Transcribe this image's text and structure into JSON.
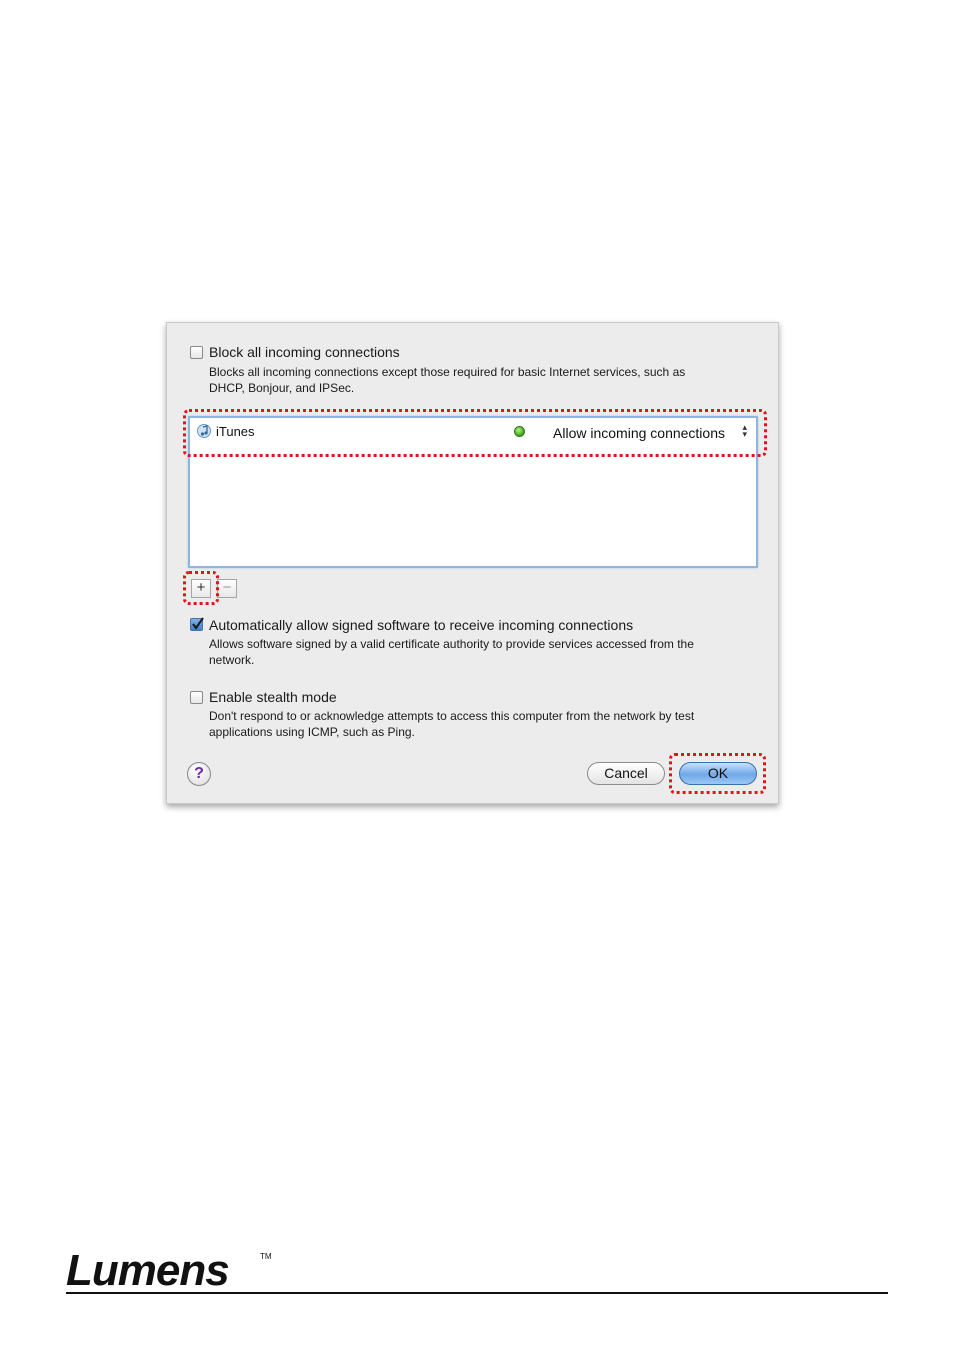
{
  "dialog": {
    "block": {
      "title": "Block all incoming connections",
      "desc": "Blocks all incoming connections except those required for basic Internet services, such as DHCP, Bonjour, and IPSec.",
      "checked": false
    },
    "list": {
      "rows": [
        {
          "app_name": "iTunes",
          "status": "Allow incoming connections",
          "status_color": "#3aa314"
        }
      ]
    },
    "add_label": "+",
    "remove_label": "−",
    "auto_allow": {
      "title": "Automatically allow signed software to receive incoming connections",
      "desc": "Allows software signed by a valid certificate authority to provide services accessed from the network.",
      "checked": true
    },
    "stealth": {
      "title": "Enable stealth mode",
      "desc": "Don't respond to or acknowledge attempts to access this computer from the network by test applications using ICMP, such as Ping.",
      "checked": false
    },
    "help_label": "?",
    "cancel_label": "Cancel",
    "ok_label": "OK"
  },
  "footer": {
    "brand": "Lumens",
    "trademark": "TM"
  },
  "colors": {
    "highlight": "#e0141e",
    "accent": "#3d7fd1"
  }
}
